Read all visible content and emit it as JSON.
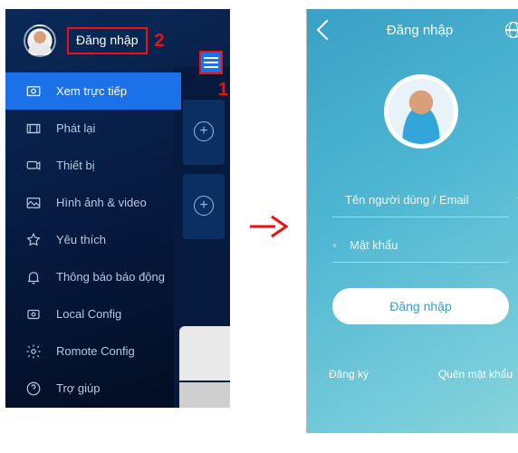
{
  "left": {
    "login_box_label": "Đăng nhập",
    "marker1": "1",
    "marker2": "2",
    "menu": [
      {
        "label": "Xem trực tiếp",
        "icon": "live-view-icon",
        "active": true
      },
      {
        "label": "Phát lại",
        "icon": "playback-icon"
      },
      {
        "label": "Thiết bị",
        "icon": "device-icon"
      },
      {
        "label": "Hình ảnh & video",
        "icon": "media-icon"
      },
      {
        "label": "Yêu thích",
        "icon": "favorite-icon"
      },
      {
        "label": "Thông báo báo động",
        "icon": "alarm-icon"
      },
      {
        "label": "Local Config",
        "icon": "local-config-icon"
      },
      {
        "label": "Romote Config",
        "icon": "remote-config-icon"
      },
      {
        "label": "Trợ giúp",
        "icon": "help-icon"
      }
    ]
  },
  "right": {
    "title": "Đăng nhập",
    "username_placeholder": "Tên người dùng / Email",
    "password_placeholder": "Mật khẩu",
    "login_button": "Đăng nhập",
    "register": "Đăng ký",
    "forgot": "Quên mật khẩu"
  }
}
